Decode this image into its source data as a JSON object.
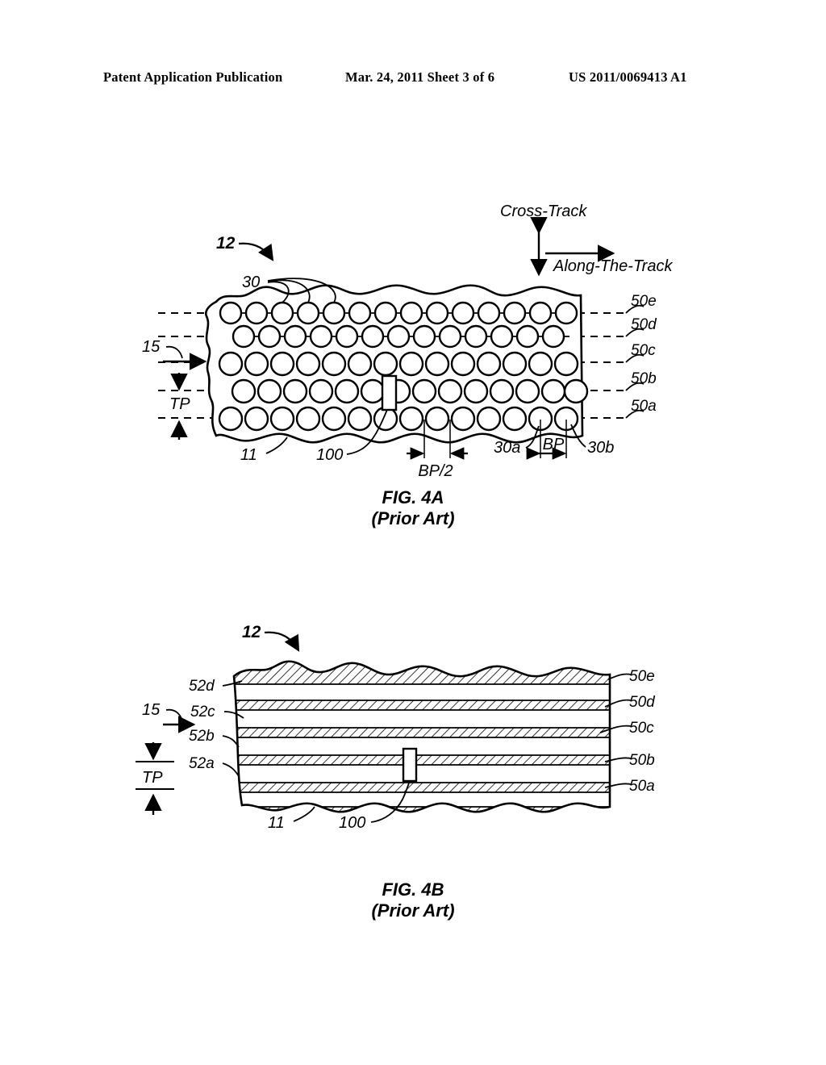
{
  "header": {
    "publication": "Patent Application Publication",
    "date_sheet": "Mar. 24, 2011  Sheet 3 of 6",
    "patent_number": "US 2011/0069413 A1"
  },
  "figures": [
    {
      "id": "fig-4a",
      "caption": "FIG. 4A",
      "subcaption": "(Prior Art)",
      "type": "plan-view-bit-patterned-media",
      "axis_legend": {
        "vertical_label": "Cross-Track",
        "horizontal_label": "Along-The-Track"
      },
      "callouts": {
        "disk": "12",
        "dots": "30",
        "substrate": "11",
        "read_head": "100",
        "track_group": "15",
        "track_pitch": "TP",
        "bit_a": "30a",
        "bit_b": "30b",
        "bit_pitch": "BP",
        "half_bit_pitch": "BP/2"
      },
      "track_labels": [
        "50e",
        "50d",
        "50c",
        "50b",
        "50a"
      ],
      "rows": 5,
      "dots_per_row": 14,
      "stagger": "odd rows aligned, even rows offset by half bit pitch"
    },
    {
      "id": "fig-4b",
      "caption": "FIG. 4B",
      "subcaption": "(Prior Art)",
      "type": "plan-view-continuous-media",
      "callouts": {
        "disk": "12",
        "substrate": "11",
        "read_head": "100",
        "track_group": "15",
        "track_pitch": "TP"
      },
      "track_labels": [
        "50e",
        "50d",
        "50c",
        "50b",
        "50a"
      ],
      "guard_labels": [
        "52d",
        "52c",
        "52b",
        "52a"
      ]
    }
  ],
  "colors": {
    "ink": "#000000",
    "paper": "#ffffff",
    "hatch": "#000000"
  }
}
